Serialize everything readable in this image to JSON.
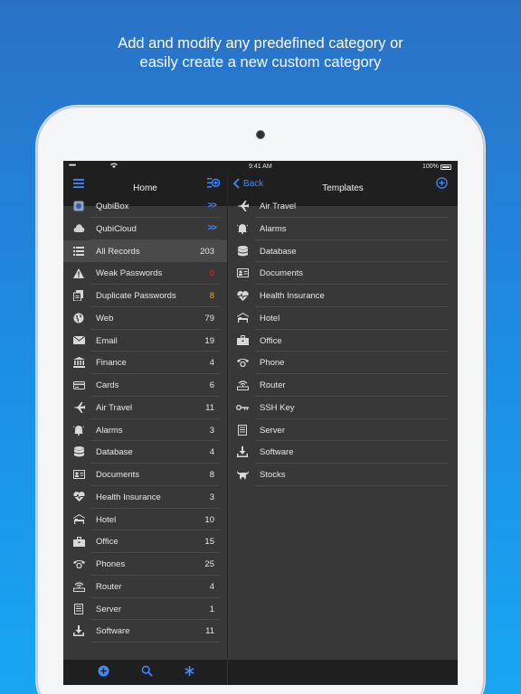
{
  "headline": {
    "line1": "Add and modify any predefined category or",
    "line2": "easily create a new custom category"
  },
  "status_bar": {
    "signal": "•••••",
    "time": "9:41 AM",
    "battery": "100%"
  },
  "left_pane": {
    "title": "Home",
    "items": [
      {
        "label": "QubiBox",
        "count": "",
        "chevron": ">>",
        "icon": "qubibox-icon"
      },
      {
        "label": "QubiCloud",
        "count": "",
        "chevron": ">>",
        "icon": "cloud-icon"
      },
      {
        "label": "All Records",
        "count": "203",
        "icon": "list-icon",
        "selected": true
      },
      {
        "label": "Weak Passwords",
        "count": "0",
        "icon": "warning-icon",
        "count_color": "#e0302a"
      },
      {
        "label": "Duplicate Passwords",
        "count": "8",
        "icon": "duplicate-icon",
        "count_color": "#f3a81b"
      },
      {
        "label": "Web",
        "count": "79",
        "icon": "globe-icon"
      },
      {
        "label": "Email",
        "count": "19",
        "icon": "envelope-icon"
      },
      {
        "label": "Finance",
        "count": "4",
        "icon": "bank-icon"
      },
      {
        "label": "Cards",
        "count": "6",
        "icon": "card-icon"
      },
      {
        "label": "Air Travel",
        "count": "11",
        "icon": "airplane-icon"
      },
      {
        "label": "Alarms",
        "count": "3",
        "icon": "alarm-icon"
      },
      {
        "label": "Database",
        "count": "4",
        "icon": "database-icon"
      },
      {
        "label": "Documents",
        "count": "8",
        "icon": "id-card-icon"
      },
      {
        "label": "Health Insurance",
        "count": "3",
        "icon": "heartbeat-icon"
      },
      {
        "label": "Hotel",
        "count": "10",
        "icon": "bed-icon"
      },
      {
        "label": "Office",
        "count": "15",
        "icon": "briefcase-icon"
      },
      {
        "label": "Phones",
        "count": "25",
        "icon": "phone-icon"
      },
      {
        "label": "Router",
        "count": "4",
        "icon": "router-icon"
      },
      {
        "label": "Server",
        "count": "1",
        "icon": "server-icon"
      },
      {
        "label": "Software",
        "count": "11",
        "icon": "download-icon"
      }
    ]
  },
  "right_pane": {
    "back_label": "Back",
    "title": "Templates",
    "items": [
      {
        "label": "Air Travel",
        "icon": "airplane-icon"
      },
      {
        "label": "Alarms",
        "icon": "alarm-icon"
      },
      {
        "label": "Database",
        "icon": "database-icon"
      },
      {
        "label": "Documents",
        "icon": "id-card-icon"
      },
      {
        "label": "Health Insurance",
        "icon": "heartbeat-icon"
      },
      {
        "label": "Hotel",
        "icon": "bed-icon"
      },
      {
        "label": "Office",
        "icon": "briefcase-icon"
      },
      {
        "label": "Phone",
        "icon": "phone-icon"
      },
      {
        "label": "Router",
        "icon": "router-icon"
      },
      {
        "label": "SSH Key",
        "icon": "key-icon"
      },
      {
        "label": "Server",
        "icon": "server-icon"
      },
      {
        "label": "Software",
        "icon": "download-icon"
      },
      {
        "label": "Stocks",
        "icon": "bull-icon"
      }
    ]
  },
  "colors": {
    "accent": "#3b8cff",
    "panel": "#383838",
    "bar": "#1f1f1f"
  }
}
